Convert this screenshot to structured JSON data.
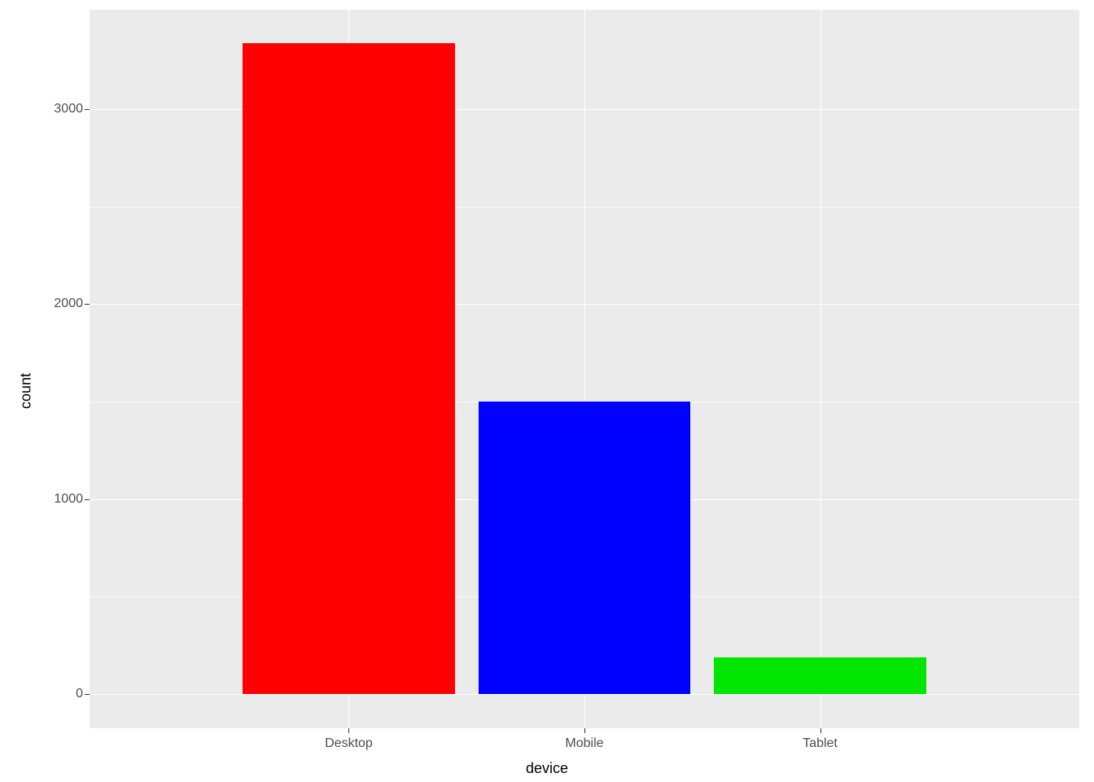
{
  "chart_data": {
    "type": "bar",
    "categories": [
      "Desktop",
      "Mobile",
      "Tablet"
    ],
    "values": [
      3340,
      1500,
      190
    ],
    "colors": [
      "#ff0000",
      "#0000ff",
      "#00e600"
    ],
    "xlabel": "device",
    "ylabel": "count",
    "y_ticks": [
      0,
      1000,
      2000,
      3000
    ],
    "ylim": [
      -175,
      3510
    ]
  }
}
